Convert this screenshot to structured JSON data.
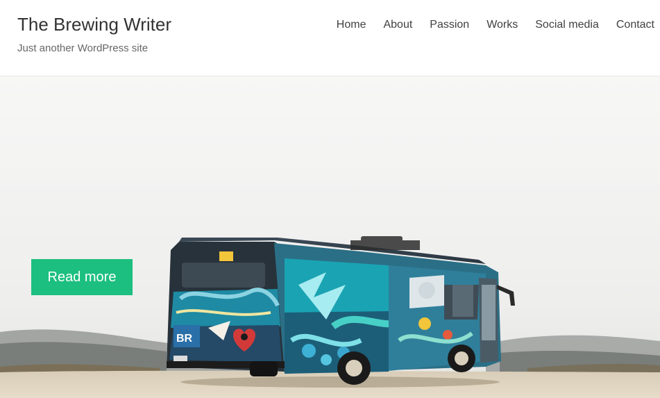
{
  "site": {
    "title": "The Brewing Writer",
    "tagline": "Just another WordPress site"
  },
  "nav": {
    "items": [
      {
        "label": "Home"
      },
      {
        "label": "About"
      },
      {
        "label": "Passion"
      },
      {
        "label": "Works"
      },
      {
        "label": "Social media"
      },
      {
        "label": "Contact"
      }
    ]
  },
  "hero": {
    "button_label": "Read more",
    "button_color": "#1cbf7f"
  }
}
